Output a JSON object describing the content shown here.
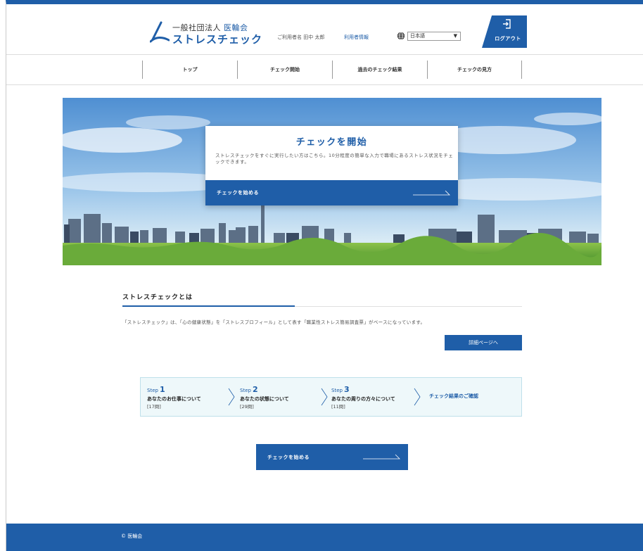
{
  "header": {
    "logo_line1": "一般社団法人",
    "logo_line1_accent": "医輪会",
    "logo_line2": "ストレスチェック",
    "user_label": "ご利用者名 田中 太郎",
    "user_info_link": "利用者情報",
    "language_selected": "日本語",
    "logout_label": "ログアウト"
  },
  "nav": {
    "items": [
      {
        "label": "トップ"
      },
      {
        "label": "チェック開始"
      },
      {
        "label": "過去のチェック結果"
      },
      {
        "label": "チェックの見方"
      }
    ]
  },
  "hero": {
    "card_title": "チェックを開始",
    "card_desc": "ストレスチェックをすぐに実行したい方はこちら。10分程度の簡単な入力で職場にあるストレス状況をチェックできます。",
    "card_button": "チェックを始める"
  },
  "about": {
    "title": "ストレスチェックとは",
    "text": "「ストレスチェック」は、「心の健康状態」を「ストレスプロフィール」として表す「職業性ストレス簡易調査票」がベースになっています。",
    "detail_button": "詳細ページへ"
  },
  "steps": {
    "items": [
      {
        "step_word": "Step",
        "num": "1",
        "desc": "あなたのお仕事について",
        "count": "[17問]"
      },
      {
        "step_word": "Step",
        "num": "2",
        "desc": "あなたの状態について",
        "count": "[29問]"
      },
      {
        "step_word": "Step",
        "num": "3",
        "desc": "あなたの周りの方々について",
        "count": "[11問]"
      }
    ],
    "final_label": "チェック結果のご確認"
  },
  "bottom_button": "チェックを始める",
  "footer": {
    "copyright": "© 医輪会"
  },
  "colors": {
    "brand": "#1f5ea8",
    "steps_bg": "#eef8fa"
  }
}
